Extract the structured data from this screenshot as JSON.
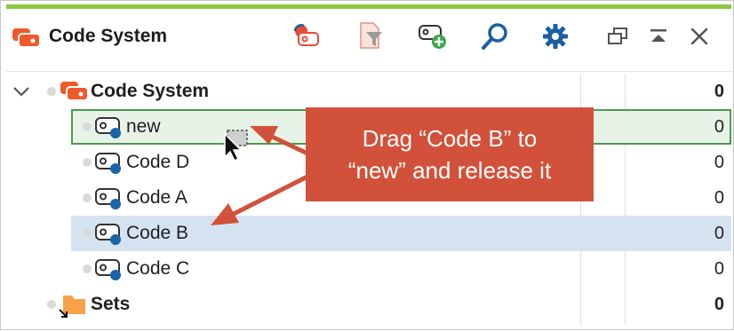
{
  "panel": {
    "title": "Code System",
    "toolbar": {
      "icons": [
        "reset-code-activation-icon",
        "filter-codes-icon",
        "new-code-icon",
        "search-icon",
        "settings-gear-icon",
        "undock-window-icon",
        "maximize-panel-icon",
        "close-icon"
      ]
    }
  },
  "tree": {
    "root": {
      "label": "Code System",
      "count": "0"
    },
    "codes": [
      {
        "label": "new",
        "count": "0",
        "state": "drop-target"
      },
      {
        "label": "Code D",
        "count": "0"
      },
      {
        "label": "Code A",
        "count": "0"
      },
      {
        "label": "Code B",
        "count": "0",
        "state": "selected"
      },
      {
        "label": "Code C",
        "count": "0"
      }
    ],
    "sets": {
      "label": "Sets",
      "count": "0"
    }
  },
  "callout": {
    "line1": "Drag “Code B” to",
    "line2": "“new” and release it"
  },
  "colors": {
    "accent_bar": "#8cc63f",
    "code_system_orange": "#f0592a",
    "code_dot_blue": "#1a64a8",
    "toolbar_blue": "#1a5fa3",
    "drop_target_border": "#4a9a4f",
    "drop_target_fill": "#e8f3e8",
    "selection_fill": "#d5e3f1",
    "callout_fill": "#d2513a",
    "sets_folder": "#f7a24b"
  }
}
